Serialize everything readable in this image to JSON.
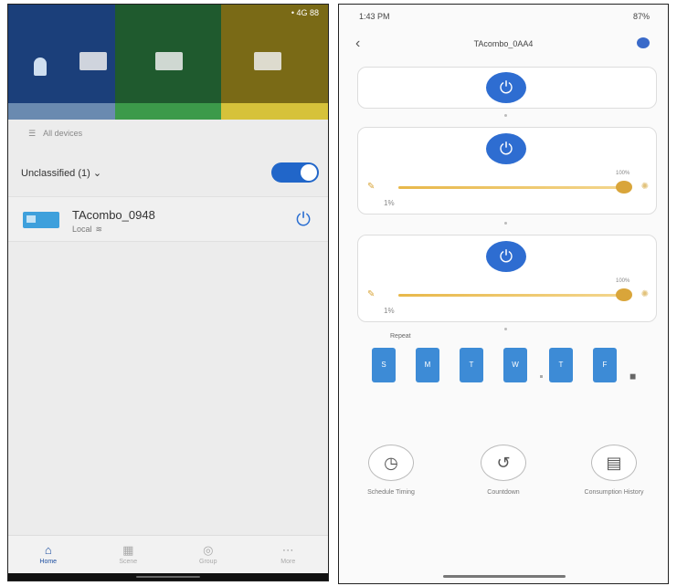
{
  "left_screen": {
    "status_bar": {
      "right": "• 4G 88"
    },
    "hero_colors": [
      "#1b3f7a",
      "#1f5a2e",
      "#7a6a16"
    ],
    "hero_stripe_colors": [
      "#6a8ab0",
      "#3c9a4a",
      "#d6c23a"
    ],
    "device_count_label": "All devices",
    "group": {
      "label": "Unclassified (1)",
      "chevron": "chevron-down-icon",
      "toggle_on": true
    },
    "device": {
      "name": "TAcombo_0948",
      "status": "Local",
      "wifi_icon": "wifi-icon",
      "power_icon": "power-icon"
    },
    "nav": [
      {
        "label": "Home",
        "icon": "home-icon",
        "active": true
      },
      {
        "label": "Scene",
        "icon": "scene-icon",
        "active": false
      },
      {
        "label": "Group",
        "icon": "group-icon",
        "active": false
      },
      {
        "label": "More",
        "icon": "more-icon",
        "active": false
      }
    ]
  },
  "right_screen": {
    "status_bar": {
      "left": "1:43 PM",
      "right": "87%"
    },
    "title": "TAcombo_0AA4",
    "accent_color": "#2e6dd1",
    "slider_color": "#e8b84a",
    "sliders": [
      {
        "min_label": "1%",
        "max_label": "100%",
        "level": 1.0
      },
      {
        "min_label": "1%",
        "max_label": "100%",
        "level": 1.0
      }
    ],
    "repeat_label": "Repeat",
    "days": [
      "S",
      "M",
      "T",
      "W",
      "T",
      "F"
    ],
    "actions": [
      {
        "label": "Schedule Timing",
        "icon": "clock-icon"
      },
      {
        "label": "Countdown",
        "icon": "countdown-icon"
      },
      {
        "label": "Consumption History",
        "icon": "history-icon"
      }
    ]
  }
}
